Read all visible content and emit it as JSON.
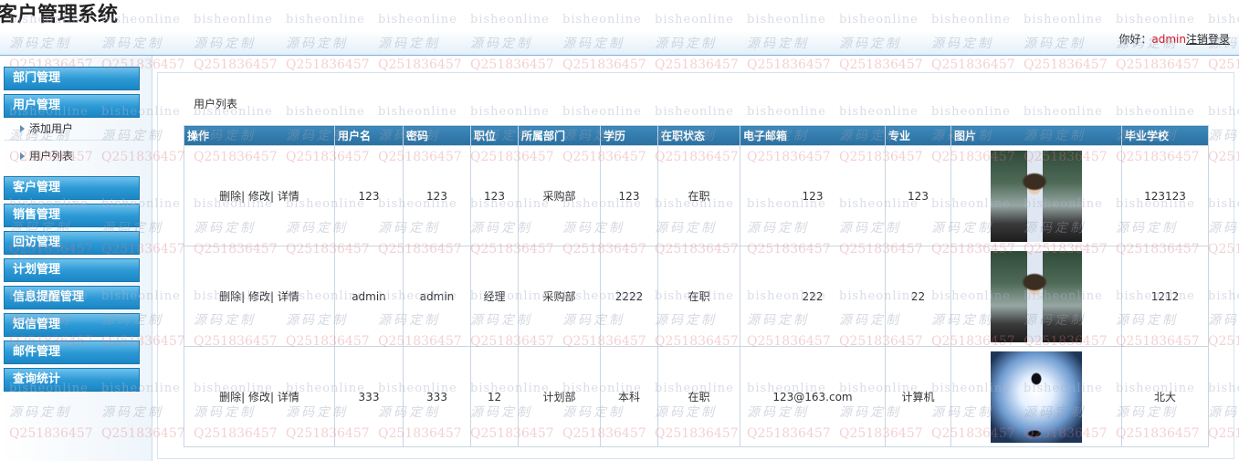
{
  "app": {
    "title": "客户管理系统"
  },
  "header": {
    "greeting": "你好：",
    "username": "admin",
    "logout": "注销登录"
  },
  "sidebar": {
    "items": [
      {
        "label": "部门管理"
      },
      {
        "label": "用户管理"
      },
      {
        "label": "客户管理"
      },
      {
        "label": "销售管理"
      },
      {
        "label": "回访管理"
      },
      {
        "label": "计划管理"
      },
      {
        "label": "信息提醒管理"
      },
      {
        "label": "短信管理"
      },
      {
        "label": "邮件管理"
      },
      {
        "label": "查询统计"
      }
    ],
    "submenu": [
      {
        "label": "添加用户"
      },
      {
        "label": "用户列表"
      }
    ]
  },
  "main": {
    "section_title": "用户列表",
    "columns": [
      "操作",
      "用户名",
      "密码",
      "职位",
      "所属部门",
      "学历",
      "在职状态",
      "电子邮箱",
      "专业",
      "图片",
      "毕业学校"
    ],
    "actions": {
      "delete": "删除|",
      "edit": "修改|",
      "detail": "详情"
    },
    "rows": [
      {
        "username": "123",
        "password": "123",
        "position": "123",
        "dept": "采购部",
        "education": "123",
        "status": "在职",
        "email": "123",
        "major": "123",
        "image": "teacher-photo",
        "school": "123123"
      },
      {
        "username": "admin",
        "password": "admin",
        "position": "经理",
        "dept": "采购部",
        "education": "2222",
        "status": "在职",
        "email": "222",
        "major": "22",
        "image": "teacher-photo",
        "school": "1212"
      },
      {
        "username": "333",
        "password": "333",
        "position": "12",
        "dept": "计划部",
        "education": "本科",
        "status": "在职",
        "email": "123@163.com",
        "major": "计算机",
        "image": "runner-photo",
        "school": "北大"
      }
    ]
  },
  "watermark": {
    "site": "bisheonline",
    "label": "源码定制",
    "qq": "Q251836457"
  }
}
